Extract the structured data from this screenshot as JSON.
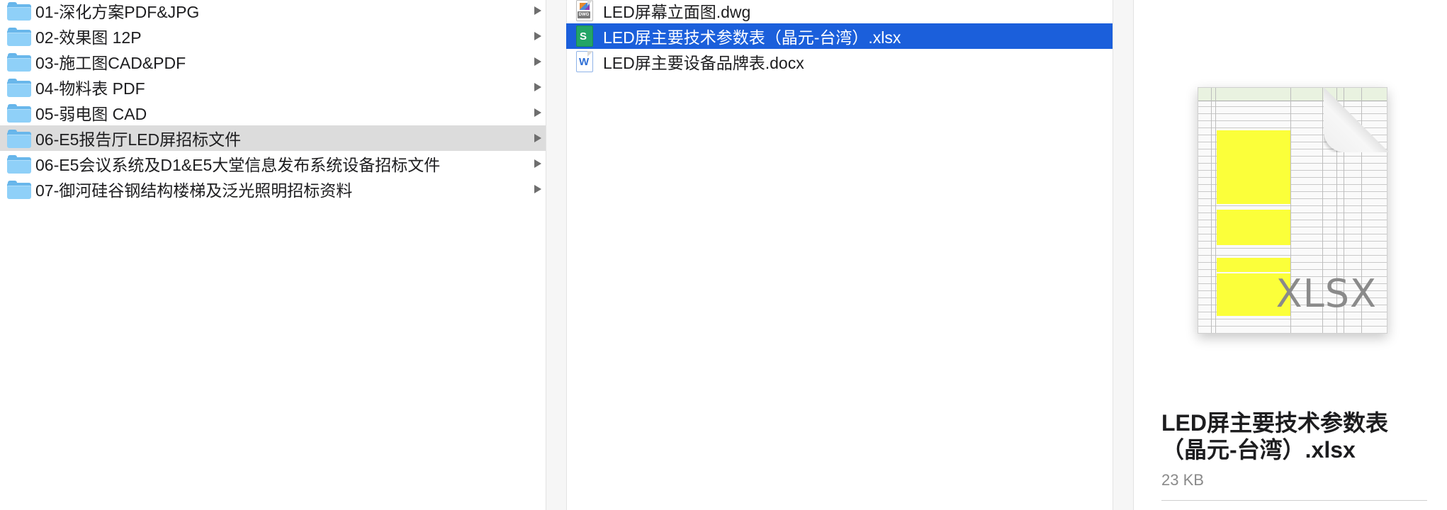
{
  "folders": [
    {
      "label": "01-深化方案PDF&JPG"
    },
    {
      "label": "02-效果图 12P"
    },
    {
      "label": "03-施工图CAD&PDF"
    },
    {
      "label": "04-物料表 PDF"
    },
    {
      "label": "05-弱电图 CAD"
    },
    {
      "label": "06-E5报告厅LED屏招标文件"
    },
    {
      "label": "06-E5会议系统及D1&E5大堂信息发布系统设备招标文件"
    },
    {
      "label": "07-御河硅谷钢结构楼梯及泛光照明招标资料"
    }
  ],
  "files": [
    {
      "label": "LED屏幕立面图.dwg",
      "icon": "dwg-file-icon"
    },
    {
      "label": "LED屏主要技术参数表（晶元-台湾）.xlsx",
      "icon": "xlsx-file-icon"
    },
    {
      "label": "LED屏主要设备品牌表.docx",
      "icon": "docx-file-icon"
    }
  ],
  "preview": {
    "thumbnail_ext": "XLSX",
    "title": "LED屏主要技术参数表（晶元-台湾）.xlsx",
    "size": "23 KB"
  },
  "colors": {
    "selection": "#1b5fdb",
    "parent_highlight": "#dcdcdc",
    "folder": "#8fd0f8"
  }
}
